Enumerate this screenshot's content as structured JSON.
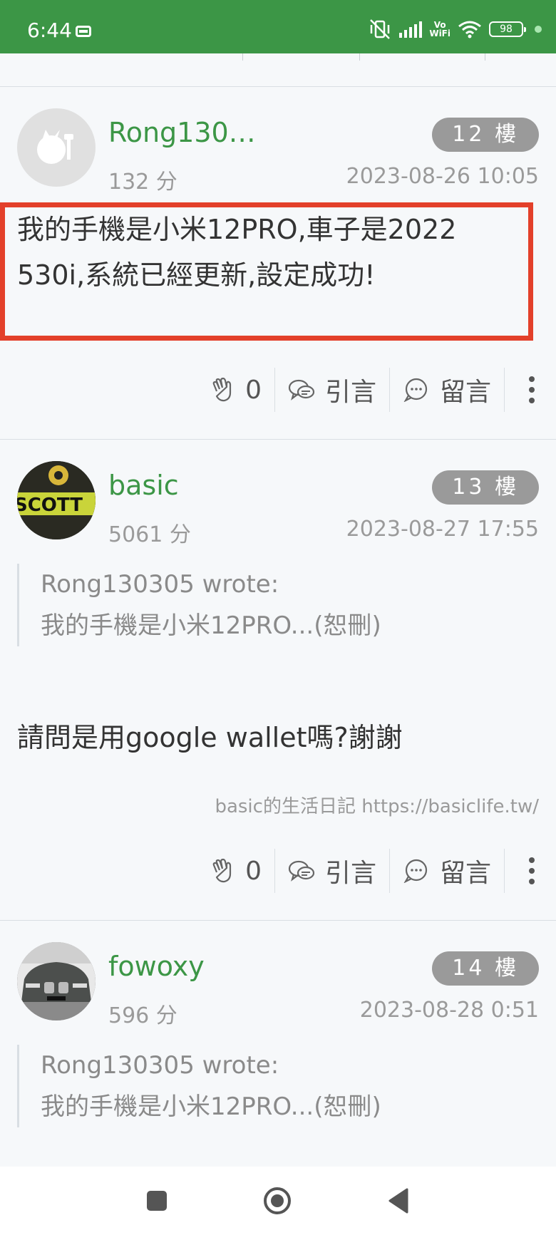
{
  "status_bar": {
    "time": "6:44",
    "vo_label": "Vo",
    "wifi_label": "WiFi",
    "battery": "98"
  },
  "posts": [
    {
      "username": "Rong130…",
      "floor": "12 樓",
      "score": "132 分",
      "date": "2023-08-26 10:05",
      "content_lines": [
        "我的手機是小米12PRO,車子是2022",
        "530i,系統已經更新,設定成功!"
      ],
      "likes": "0",
      "quote_label": "引言",
      "comment_label": "留言"
    },
    {
      "username": "basic",
      "floor": "13 樓",
      "score": "5061 分",
      "date": "2023-08-27 17:55",
      "quote_author": "Rong130305 wrote:",
      "quote_text": "我的手機是小米12PRO...(恕刪)",
      "content": "請問是用google wallet嗎?謝謝",
      "signature": "basic的生活日記 https://basiclife.tw/",
      "likes": "0",
      "quote_label": "引言",
      "comment_label": "留言"
    },
    {
      "username": "fowoxy",
      "floor": "14 樓",
      "score": "596 分",
      "date": "2023-08-28 0:51",
      "quote_author": "Rong130305 wrote:",
      "quote_text": "我的手機是小米12PRO...(恕刪)"
    }
  ],
  "colors": {
    "brand": "#3c9646",
    "highlight": "#e3402a",
    "badge": "#9a9a9a"
  }
}
